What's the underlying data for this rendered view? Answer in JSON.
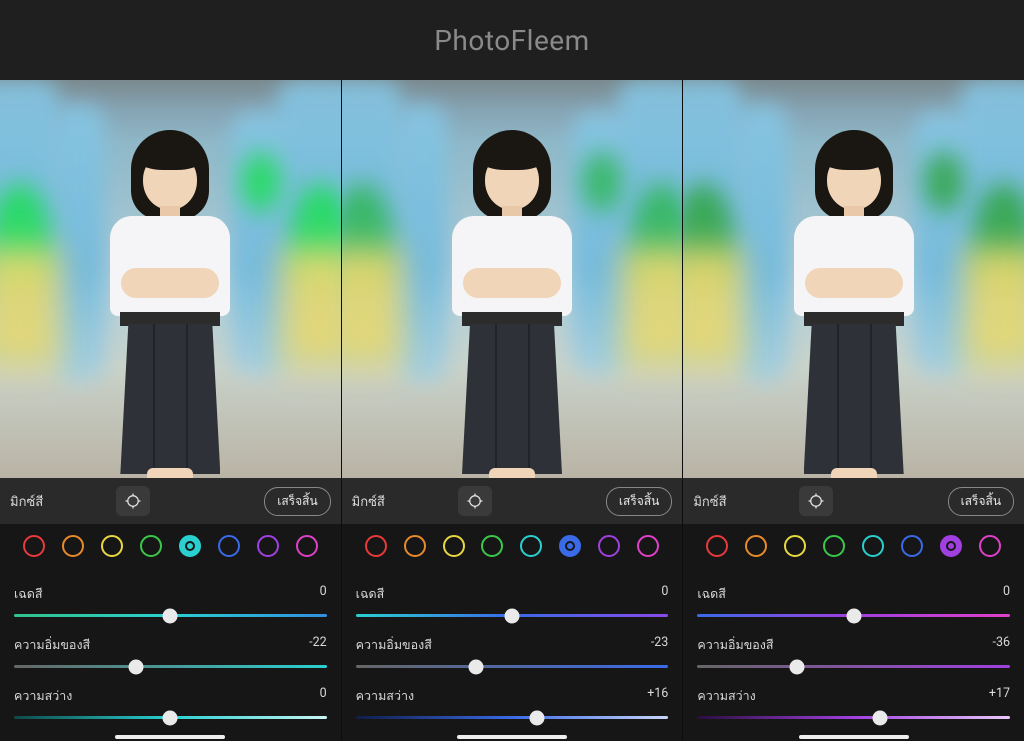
{
  "header": {
    "title": "PhotoFleem"
  },
  "labels": {
    "color_mix": "มิกซ์สี",
    "done": "เสร็จสิ้น",
    "hue": "เฉดสี",
    "saturation": "ความอิ่มของสี",
    "luminance": "ความสว่าง"
  },
  "swatch_colors": [
    "#e83a3a",
    "#e88a2a",
    "#e8d840",
    "#3ac84a",
    "#2ad0d0",
    "#3a6ae8",
    "#a040e0",
    "#e040c8"
  ],
  "slider_colors_base": {
    "hue_weak": "#555",
    "sat_weak": "#555"
  },
  "panels": [
    {
      "name": "aqua",
      "selected_swatch_index": 4,
      "sliders": {
        "hue": {
          "value": 0,
          "pos": 50,
          "gradient": [
            "#31c38b",
            "#2ad0d0",
            "#2f8fe0"
          ]
        },
        "saturation": {
          "value": -22,
          "pos": 39,
          "gradient": [
            "#666666",
            "#2ad0d0"
          ]
        },
        "luminance": {
          "value": 0,
          "pos": 50,
          "gradient": [
            "#0d4a4a",
            "#2ad0d0",
            "#c8f5f5"
          ]
        }
      }
    },
    {
      "name": "blue",
      "selected_swatch_index": 5,
      "sliders": {
        "hue": {
          "value": 0,
          "pos": 50,
          "gradient": [
            "#2ad0d0",
            "#3a6ae8",
            "#8a4ae8"
          ]
        },
        "saturation": {
          "value": -23,
          "pos": 38.5,
          "gradient": [
            "#666666",
            "#3a6ae8"
          ]
        },
        "luminance": {
          "value": 16,
          "pos": 58,
          "gradient": [
            "#101d4a",
            "#3a6ae8",
            "#c8d5f8"
          ]
        }
      }
    },
    {
      "name": "purple",
      "selected_swatch_index": 6,
      "sliders": {
        "hue": {
          "value": 0,
          "pos": 50,
          "gradient": [
            "#3a6ae8",
            "#a040e0",
            "#e040c8"
          ]
        },
        "saturation": {
          "value": -36,
          "pos": 32,
          "gradient": [
            "#666666",
            "#a040e0"
          ]
        },
        "luminance": {
          "value": 17,
          "pos": 58.5,
          "gradient": [
            "#2a0d40",
            "#a040e0",
            "#e8c8f8"
          ]
        }
      }
    }
  ]
}
